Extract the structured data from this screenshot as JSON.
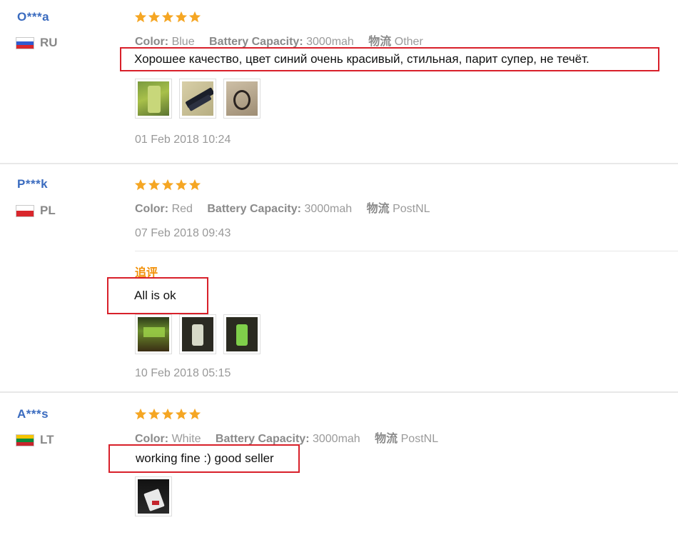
{
  "reviews": [
    {
      "user": "O***a",
      "country": "RU",
      "flag_colors": [
        "#ffffff",
        "#2f5bd0",
        "#d9262c"
      ],
      "attributes": {
        "color_label": "Color:",
        "color_value": "Blue",
        "battery_label": "Battery Capacity:",
        "battery_value": "3000mah",
        "logistics_label": "物流",
        "logistics_value": "Other"
      },
      "feedback": "Хорошее качество, цвет синий очень красивый, стильная, парит супер, не течёт.",
      "date": "01 Feb 2018 10:24",
      "photo_count": 3
    },
    {
      "user": "P***k",
      "country": "PL",
      "flag_colors": [
        "#ffffff",
        "#d9262c"
      ],
      "attributes": {
        "color_label": "Color:",
        "color_value": "Red",
        "battery_label": "Battery Capacity:",
        "battery_value": "3000mah",
        "logistics_label": "物流",
        "logistics_value": "PostNL"
      },
      "date": "07 Feb 2018 09:43",
      "followup": {
        "label": "追评",
        "feedback": "All is ok",
        "date": "10 Feb 2018 05:15",
        "photo_count": 3
      }
    },
    {
      "user": "A***s",
      "country": "LT",
      "flag_colors": [
        "#f6c400",
        "#0a8a3c",
        "#c8242c"
      ],
      "attributes": {
        "color_label": "Color:",
        "color_value": "White",
        "battery_label": "Battery Capacity:",
        "battery_value": "3000mah",
        "logistics_label": "物流",
        "logistics_value": "PostNL"
      },
      "feedback": "working fine :) good seller",
      "photo_count": 1
    }
  ],
  "rating": 5,
  "star_color": "#f5a623",
  "highlight_color": "#d8202a"
}
